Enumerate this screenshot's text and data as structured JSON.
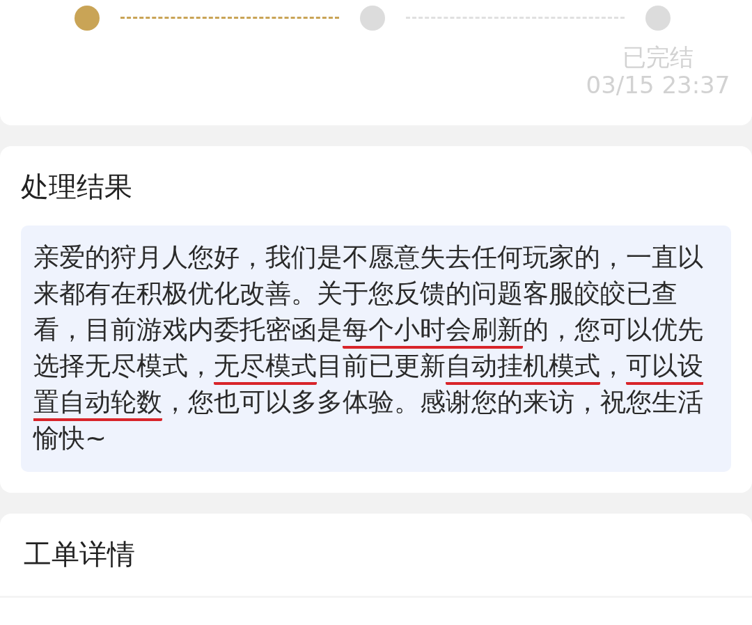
{
  "progress": {
    "steps": [
      {
        "done": true
      },
      {
        "done": false
      },
      {
        "done": false,
        "label": "已完结",
        "time": "03/15 23:37"
      }
    ]
  },
  "result": {
    "title": "处理结果",
    "segments": [
      {
        "text": "亲爱的狩月人您好，我们是不愿意失去任何玩家的，一直以来都有在积极优化改善。关于您反馈的问题客服皎皎已查看，目前游戏内委托密函是",
        "underlined": false
      },
      {
        "text": "每个小时会刷新",
        "underlined": true
      },
      {
        "text": "的，您可以优先选择无尽模式，",
        "underlined": false
      },
      {
        "text": "无尽模式",
        "underlined": true
      },
      {
        "text": "目前已更新",
        "underlined": false
      },
      {
        "text": "自动挂机模式",
        "underlined": true
      },
      {
        "text": "，",
        "underlined": false
      },
      {
        "text": "可以设置自动轮数",
        "underlined": true
      },
      {
        "text": "，您也可以多多体验。感谢您的来访，祝您生活愉快~",
        "underlined": false
      }
    ]
  },
  "details": {
    "title": "工单详情"
  }
}
